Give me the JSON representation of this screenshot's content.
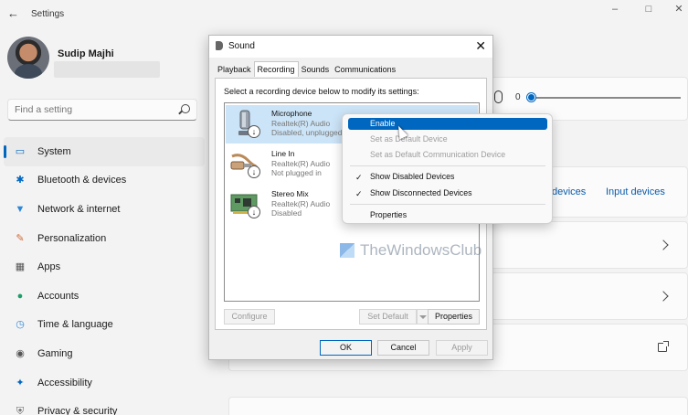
{
  "settings": {
    "app_title": "Settings",
    "user": {
      "name": "Sudip Majhi"
    },
    "search": {
      "placeholder": "Find a setting"
    },
    "nav": [
      {
        "label": "System",
        "icon": "monitor-icon",
        "selected": true
      },
      {
        "label": "Bluetooth & devices",
        "icon": "bluetooth-icon"
      },
      {
        "label": "Network & internet",
        "icon": "wifi-icon"
      },
      {
        "label": "Personalization",
        "icon": "brush-icon"
      },
      {
        "label": "Apps",
        "icon": "apps-icon"
      },
      {
        "label": "Accounts",
        "icon": "person-icon"
      },
      {
        "label": "Time & language",
        "icon": "globe-clock-icon"
      },
      {
        "label": "Gaming",
        "icon": "gamepad-icon"
      },
      {
        "label": "Accessibility",
        "icon": "accessibility-icon"
      },
      {
        "label": "Privacy & security",
        "icon": "shield-icon"
      }
    ],
    "volume": {
      "level": "0"
    },
    "links": {
      "output_devices_partial": "devices",
      "input_devices": "Input devices"
    }
  },
  "sound_dialog": {
    "title": "Sound",
    "tabs": [
      "Playback",
      "Recording",
      "Sounds",
      "Communications"
    ],
    "active_tab": "Recording",
    "instruction": "Select a recording device below to modify its settings:",
    "devices": [
      {
        "name": "Microphone",
        "driver": "Realtek(R) Audio",
        "status": "Disabled, unplugged",
        "icon": "microphone-device-icon"
      },
      {
        "name": "Line In",
        "driver": "Realtek(R) Audio",
        "status": "Not plugged in",
        "icon": "line-in-jack-icon"
      },
      {
        "name": "Stereo Mix",
        "driver": "Realtek(R) Audio",
        "status": "Disabled",
        "icon": "circuit-board-icon"
      }
    ],
    "buttons": {
      "configure": "Configure",
      "set_default": "Set Default",
      "properties": "Properties",
      "ok": "OK",
      "cancel": "Cancel",
      "apply": "Apply"
    }
  },
  "context_menu": {
    "items": [
      {
        "label": "Enable",
        "state": "highlight"
      },
      {
        "label": "Set as Default Device",
        "state": "disabled"
      },
      {
        "label": "Set as Default Communication Device",
        "state": "disabled"
      },
      {
        "label": "Show Disabled Devices",
        "checked": true
      },
      {
        "label": "Show Disconnected Devices",
        "checked": true
      },
      {
        "label": "Properties"
      }
    ]
  },
  "watermark": {
    "text": "TheWindowsClub"
  },
  "colors": {
    "accent": "#0067c0",
    "selection": "#cce4f7"
  }
}
